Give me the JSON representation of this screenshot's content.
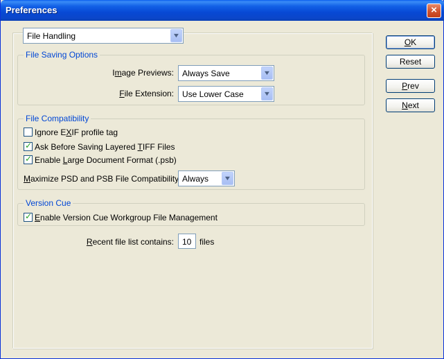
{
  "window": {
    "title": "Preferences",
    "close_label": "×"
  },
  "category_select": {
    "value": "File Handling"
  },
  "file_saving": {
    "legend": "File Saving Options",
    "image_previews": {
      "label_pre": "I",
      "label_u": "m",
      "label_post": "age Previews:",
      "value": "Always Save"
    },
    "file_extension": {
      "label_pre": "",
      "label_u": "F",
      "label_post": "ile Extension:",
      "value": "Use Lower Case"
    }
  },
  "file_compat": {
    "legend": "File Compatibility",
    "checks": [
      {
        "pre": "Ignore E",
        "u": "X",
        "post": "IF profile tag",
        "checked": false
      },
      {
        "pre": "Ask Before Saving Layered ",
        "u": "T",
        "post": "IFF Files",
        "checked": true
      },
      {
        "pre": "Enable ",
        "u": "L",
        "post": "arge Document Format (.psb)",
        "checked": true
      }
    ],
    "maximize": {
      "label_pre": "",
      "label_u": "M",
      "label_post": "aximize PSD and PSB File Compatibility:",
      "value": "Always"
    }
  },
  "version_cue": {
    "legend": "Version Cue",
    "check": {
      "pre": "",
      "u": "E",
      "post": "nable Version Cue Workgroup File Management",
      "checked": true
    }
  },
  "recent": {
    "label_pre": "",
    "label_u": "R",
    "label_post": "ecent file list contains:",
    "value": "10",
    "suffix": "files"
  },
  "buttons": {
    "ok": {
      "pre": "",
      "u": "O",
      "post": "K"
    },
    "reset": {
      "pre": "",
      "u": "",
      "post": "Reset"
    },
    "prev": {
      "pre": "",
      "u": "P",
      "post": "rev"
    },
    "next": {
      "pre": "",
      "u": "N",
      "post": "ext"
    }
  },
  "icons": {
    "dropdown": "chevron-down-icon",
    "check": "checkmark-icon"
  },
  "colors": {
    "titlebar": "#0A5FEE",
    "legend": "#0046D5",
    "face": "#ECE9D8"
  }
}
